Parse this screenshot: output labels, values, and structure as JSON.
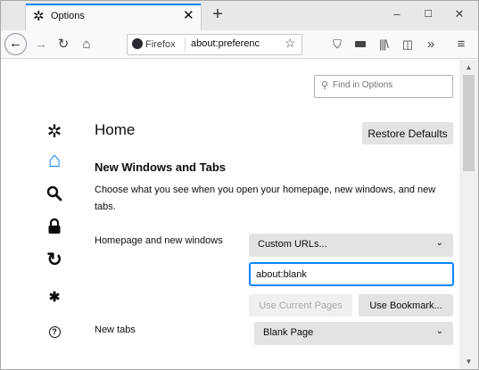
{
  "tab": {
    "title": "Options",
    "icon": "gear-icon"
  },
  "window_controls": {
    "minimize": "–",
    "maximize": "☐",
    "close": "✕"
  },
  "toolbar": {
    "identity_label": "Firefox",
    "url": "about:preferenc",
    "icons": [
      "back-icon",
      "forward-icon",
      "reload-icon",
      "home-icon",
      "bookmark-star-icon",
      "pocket-icon",
      "screenshot-icon",
      "library-icon",
      "sidebar-icon",
      "overflow-icon",
      "menu-icon"
    ]
  },
  "search": {
    "placeholder": "Find in Options"
  },
  "sidebar": {
    "items": [
      {
        "name": "general",
        "icon": "gear-icon",
        "glyph": "✲"
      },
      {
        "name": "home",
        "icon": "home-icon",
        "glyph": "⌂",
        "selected": true,
        "color": "#0a84ff"
      },
      {
        "name": "search",
        "icon": "search-icon",
        "glyph": "🔍"
      },
      {
        "name": "privacy",
        "icon": "lock-icon",
        "glyph": "🔒"
      },
      {
        "name": "sync",
        "icon": "sync-icon",
        "glyph": "⟳"
      },
      {
        "name": "extensions",
        "icon": "puzzle-icon",
        "glyph": "✱"
      },
      {
        "name": "support",
        "icon": "help-icon",
        "glyph": "?"
      }
    ]
  },
  "main": {
    "title": "Home",
    "restore_label": "Restore Defaults",
    "section_title": "New Windows and Tabs",
    "description": "Choose what you see when you open your homepage, new windows, and new tabs.",
    "homepage_label": "Homepage and new windows",
    "homepage_select": "Custom URLs...",
    "homepage_url": "about:blank",
    "use_current_label": "Use Current Pages",
    "use_bookmark_label": "Use Bookmark...",
    "newtabs_label": "New tabs",
    "newtabs_select": "Blank Page"
  },
  "colors": {
    "accent": "#0a84ff",
    "button": "#e3e3e5"
  }
}
